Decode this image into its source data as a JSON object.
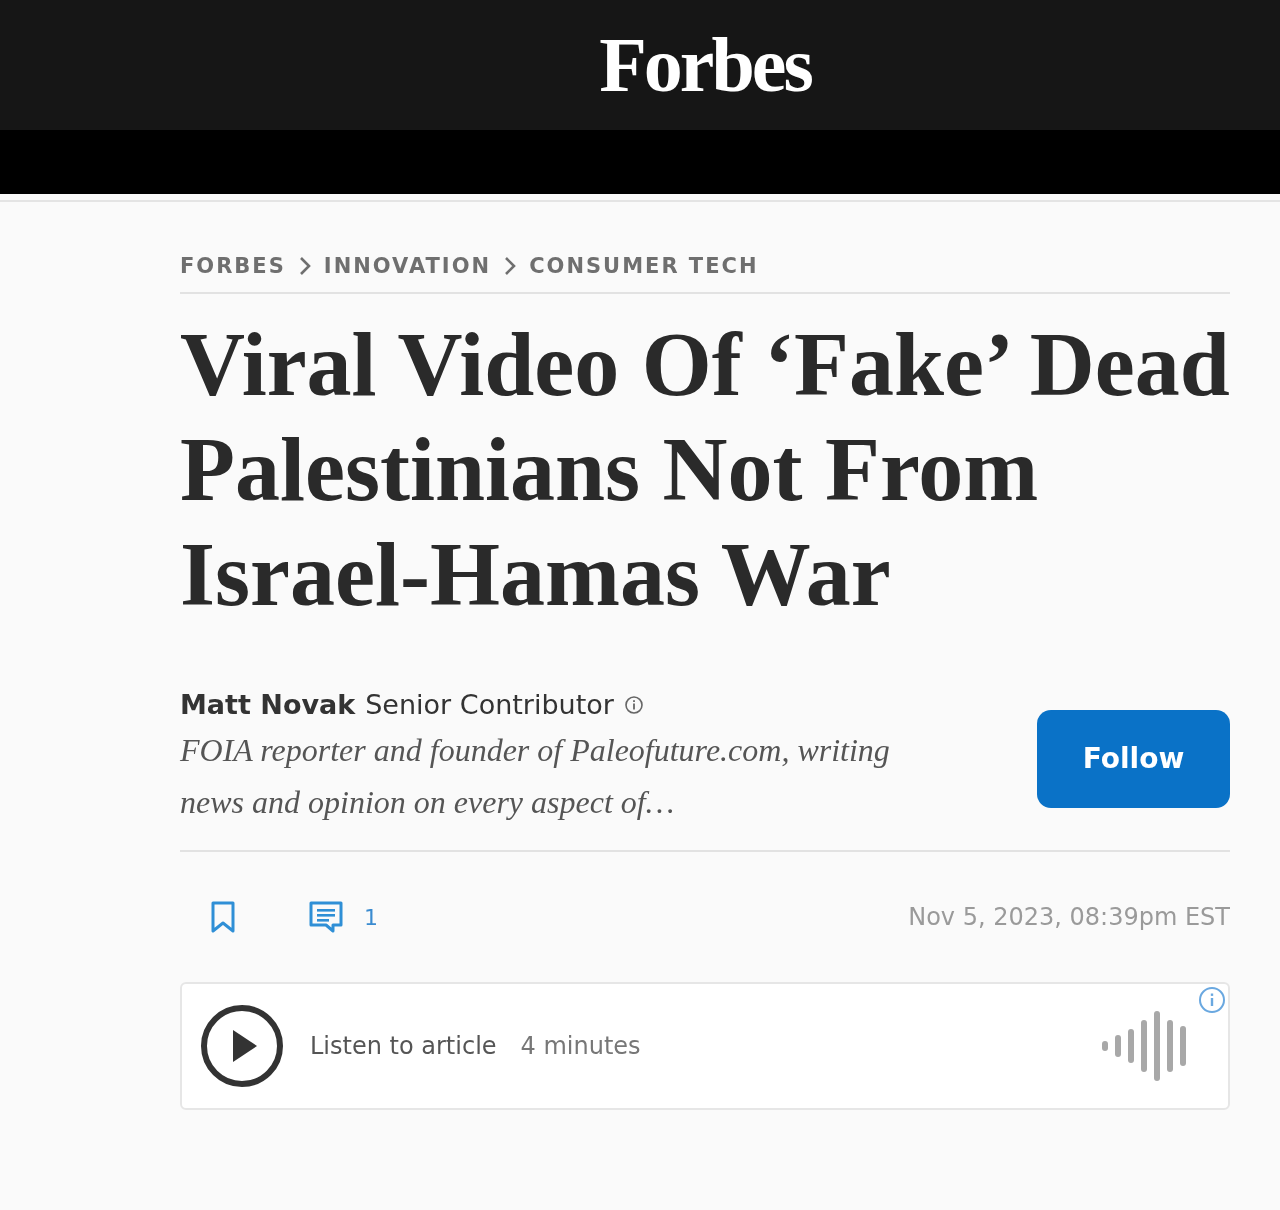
{
  "header": {
    "logo": "Forbes"
  },
  "breadcrumbs": [
    "FORBES",
    "INNOVATION",
    "CONSUMER TECH"
  ],
  "headline": "Viral Video Of ‘Fake’ Dead Palestinians Not From Israel-Hamas War",
  "author": {
    "name": "Matt Novak",
    "role": "Senior Contributor",
    "bio": "FOIA reporter and founder of Paleofuture.com, writing news and opinion on every aspect of…"
  },
  "follow_button": "Follow",
  "meta": {
    "comment_count": "1",
    "date": "Nov 5, 2023, 08:39pm EST"
  },
  "audio": {
    "label": "Listen to article",
    "duration": "4 minutes"
  }
}
